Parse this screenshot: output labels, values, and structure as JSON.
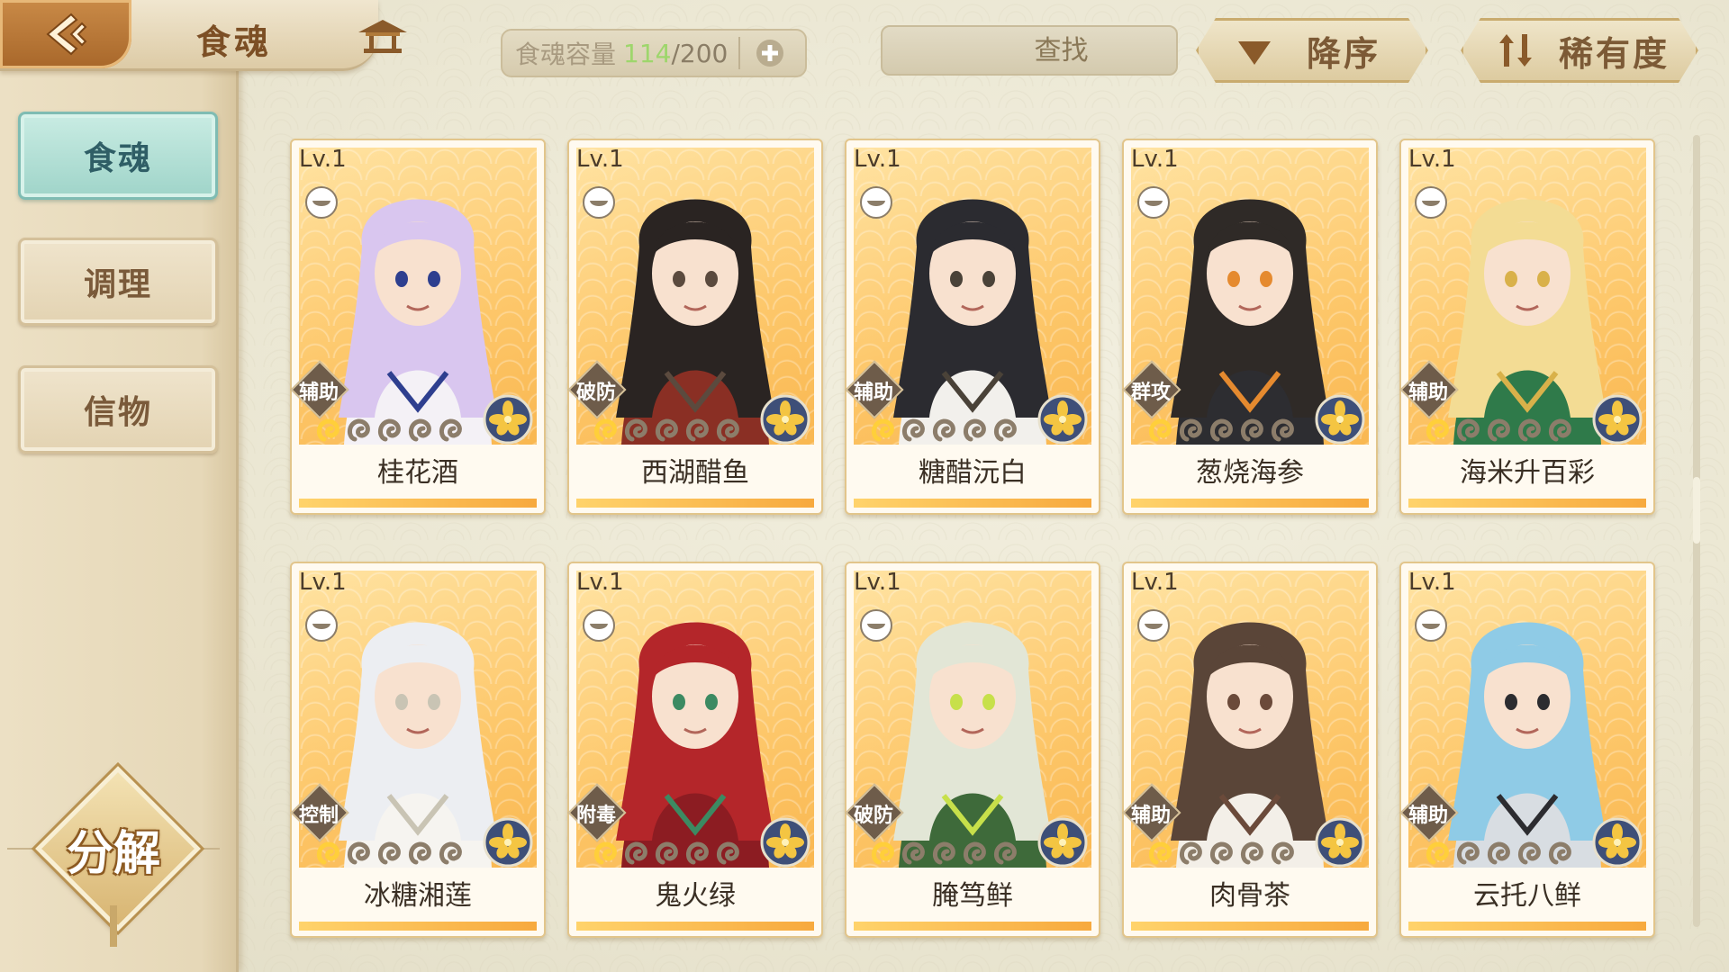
{
  "header": {
    "title": "食魂",
    "capacity": {
      "label": "食魂容量",
      "current": "114",
      "max": "/200"
    },
    "search": {
      "placeholder": "查找"
    },
    "sort_order": "降序",
    "sort_key": "稀有度"
  },
  "sidebar": {
    "tabs": [
      {
        "label": "食魂",
        "active": true
      },
      {
        "label": "调理",
        "active": false
      },
      {
        "label": "信物",
        "active": false
      }
    ],
    "decompose_label": "分解"
  },
  "cards": [
    {
      "level": "Lv.1",
      "role": "辅助",
      "name": "桂花酒",
      "stars_lit": 1,
      "stars_total": 5,
      "hair": "#d9c6ef",
      "outfit": "#f4f1f6",
      "accent": "#2e3f8f"
    },
    {
      "level": "Lv.1",
      "role": "破防",
      "name": "西湖醋鱼",
      "stars_lit": 1,
      "stars_total": 5,
      "hair": "#2a2422",
      "outfit": "#8a2f24",
      "accent": "#5b4a3e"
    },
    {
      "level": "Lv.1",
      "role": "辅助",
      "name": "糖醋沅白",
      "stars_lit": 1,
      "stars_total": 5,
      "hair": "#2b2b30",
      "outfit": "#f2f0ec",
      "accent": "#4a4238"
    },
    {
      "level": "Lv.1",
      "role": "群攻",
      "name": "葱烧海参",
      "stars_lit": 1,
      "stars_total": 5,
      "hair": "#2f2a27",
      "outfit": "#2d2d31",
      "accent": "#e58a2f"
    },
    {
      "level": "Lv.1",
      "role": "辅助",
      "name": "海米升百彩",
      "stars_lit": 1,
      "stars_total": 5,
      "hair": "#f3dc94",
      "outfit": "#2f7a4a",
      "accent": "#d9b14a"
    },
    {
      "level": "Lv.1",
      "role": "控制",
      "name": "冰糖湘莲",
      "stars_lit": 1,
      "stars_total": 5,
      "hair": "#eceef2",
      "outfit": "#f6f4f0",
      "accent": "#c9c4b4"
    },
    {
      "level": "Lv.1",
      "role": "附毒",
      "name": "鬼火绿",
      "stars_lit": 1,
      "stars_total": 5,
      "hair": "#b4262a",
      "outfit": "#8c1c22",
      "accent": "#3c8a62"
    },
    {
      "level": "Lv.1",
      "role": "破防",
      "name": "腌笃鲜",
      "stars_lit": 1,
      "stars_total": 5,
      "hair": "#e2e6d6",
      "outfit": "#3e6a3a",
      "accent": "#c7e04a"
    },
    {
      "level": "Lv.1",
      "role": "辅助",
      "name": "肉骨茶",
      "stars_lit": 1,
      "stars_total": 5,
      "hair": "#5a4538",
      "outfit": "#f3efe8",
      "accent": "#6b4a3a"
    },
    {
      "level": "Lv.1",
      "role": "辅助",
      "name": "云托八鲜",
      "stars_lit": 1,
      "stars_total": 5,
      "hair": "#8fcbe6",
      "outfit": "#d8dde2",
      "accent": "#2c2c30"
    }
  ],
  "colors": {
    "accent_teal": "#9fd4c9",
    "card_gold": "#fdc76a",
    "capacity_current": "#9ed66c"
  }
}
